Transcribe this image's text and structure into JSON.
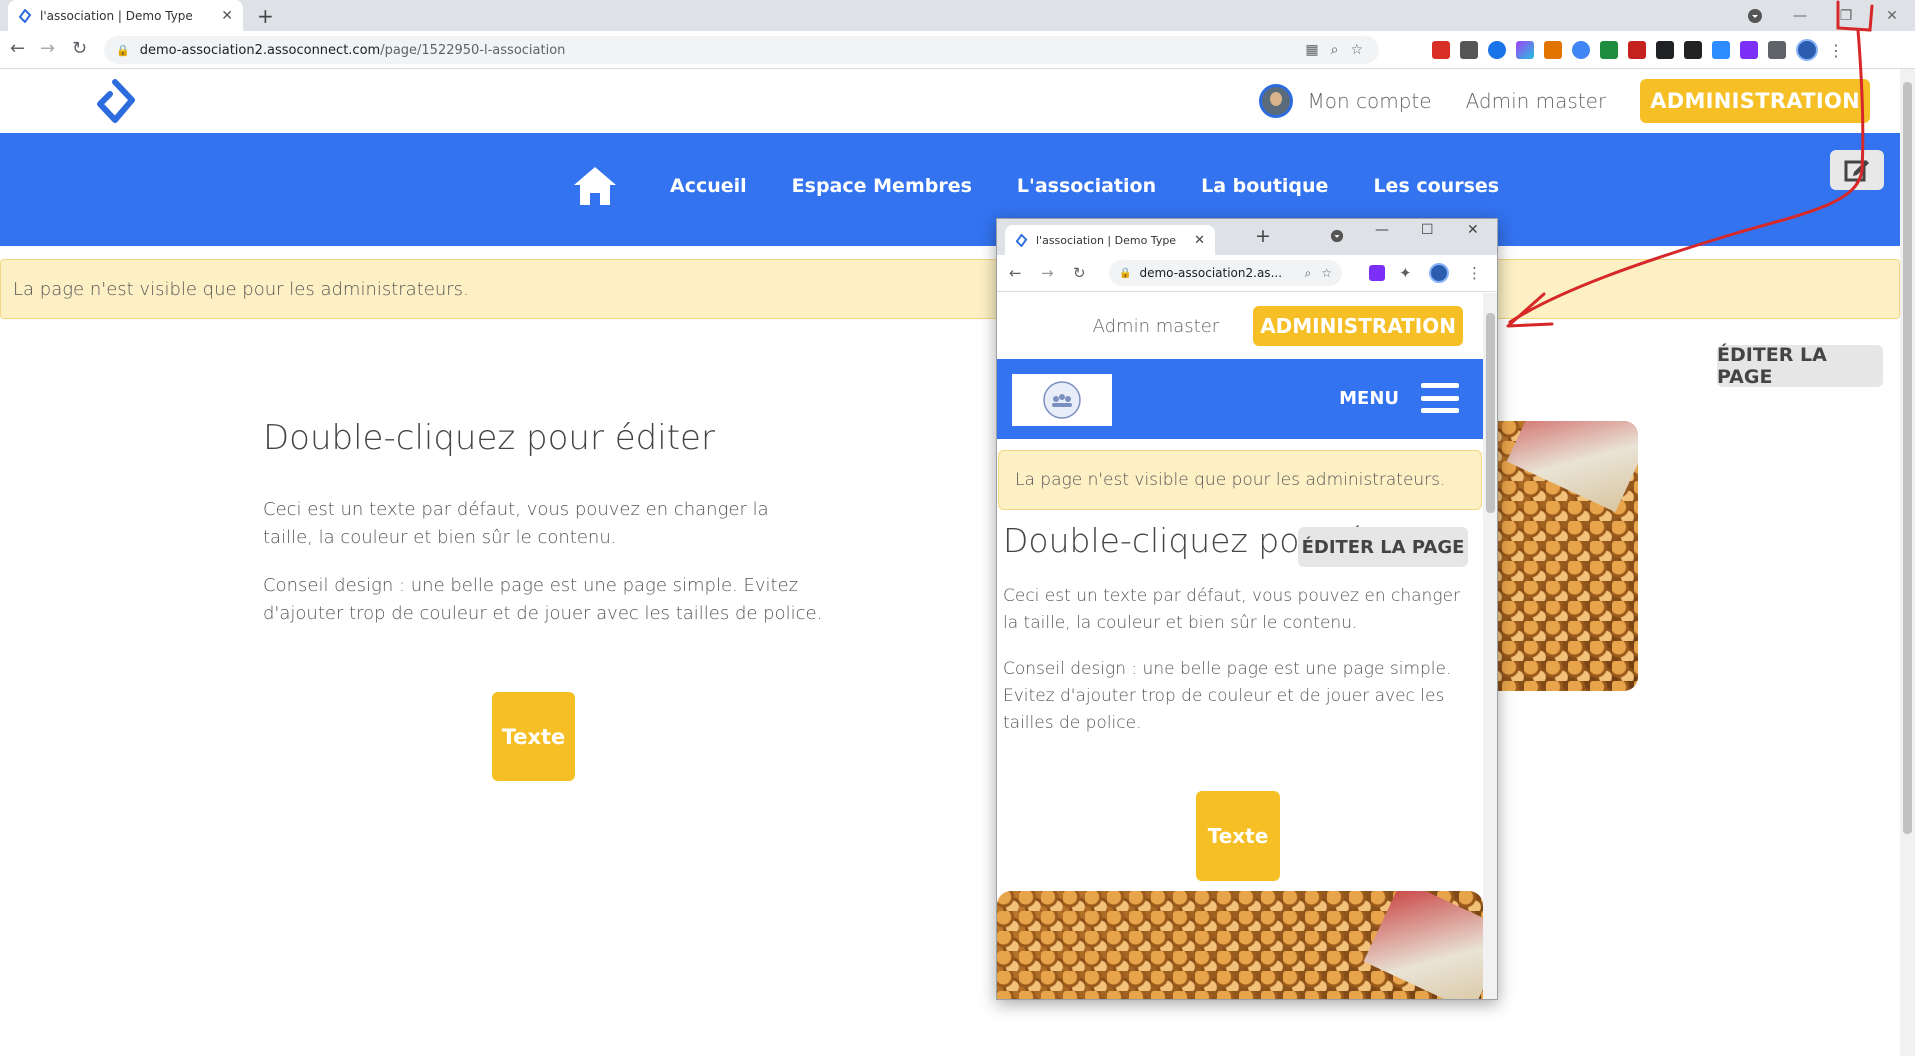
{
  "browser": {
    "tab_title": "l'association | Demo Type",
    "new_tab": "+",
    "tab_close": "✕",
    "url_domain": "demo-association2.assoconnect.com",
    "url_path": "/page/1522950-l-association",
    "win_minimize": "—",
    "win_restore": "❐",
    "win_close": "✕"
  },
  "header": {
    "account_label": "Mon compte",
    "admin_master_label": "Admin master",
    "administration_label": "ADMINISTRATION"
  },
  "nav": {
    "items": [
      {
        "label": "Accueil"
      },
      {
        "label": "Espace Membres"
      },
      {
        "label": "L'association"
      },
      {
        "label": "La boutique"
      },
      {
        "label": "Les courses"
      }
    ]
  },
  "alert": {
    "text": "La page n'est visible que pour les administrateurs."
  },
  "edit_page_label": "ÉDITER LA PAGE",
  "content": {
    "title": "Double-cliquez pour éditer",
    "paragraph1": "Ceci est un texte par défaut, vous pouvez en changer la taille, la couleur et bien sûr le contenu.",
    "paragraph2": "Conseil design : une belle page est une page simple. Evitez d'ajouter trop de couleur et de jouer avec les tailles de police.",
    "button_label": "Texte"
  },
  "popup": {
    "tab_title": "l'association | Demo Type",
    "url_text": "demo-association2.as...",
    "admin_master_label": "Admin master",
    "administration_label": "ADMINISTRATION",
    "menu_label": "MENU",
    "alert_text": "La page n'est visible que pour les administrateurs.",
    "title": "Double-cliquez pour é",
    "edit_page_label": "ÉDITER LA PAGE",
    "paragraph1": "Ceci est un texte par défaut, vous pouvez en changer la taille, la couleur et bien sûr le contenu.",
    "paragraph2": "Conseil design : une belle page est une page simple. Evitez d'ajouter trop de couleur et de jouer avec les tailles de police.",
    "button_label": "Texte"
  },
  "colors": {
    "brand_blue": "#3373f0",
    "admin_yellow": "#f6bf26",
    "alert_bg": "#fcf0c4",
    "annotation_red": "#d62828"
  },
  "icons": [
    "home-icon",
    "edit-icon",
    "hamburger-icon",
    "lock-icon",
    "star-icon",
    "zoom-icon",
    "extensions-icon"
  ]
}
